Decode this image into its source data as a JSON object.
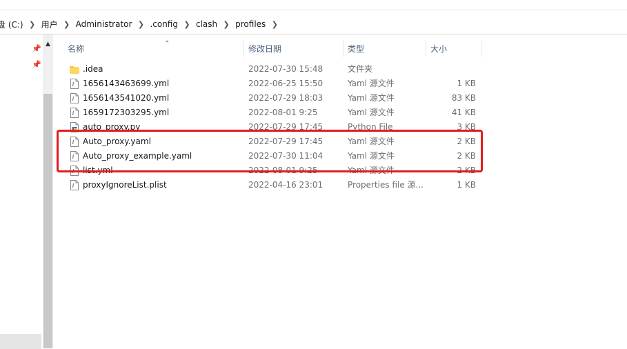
{
  "breadcrumb": {
    "items": [
      "盘 (C:)",
      "用户",
      "Administrator",
      ".config",
      "clash",
      "profiles"
    ]
  },
  "columns": {
    "name": "名称",
    "date": "修改日期",
    "type": "类型",
    "size": "大小"
  },
  "files": [
    {
      "name": ".idea",
      "date": "2022-07-30 15:48",
      "type": "文件夹",
      "size": "",
      "icon": "folder-icon"
    },
    {
      "name": "1656143463699.yml",
      "date": "2022-06-25 15:50",
      "type": "Yaml 源文件",
      "size": "1 KB",
      "icon": "yaml-file-icon"
    },
    {
      "name": "1656143541020.yml",
      "date": "2022-07-29 18:03",
      "type": "Yaml 源文件",
      "size": "83 KB",
      "icon": "yaml-file-icon"
    },
    {
      "name": "1659172303295.yml",
      "date": "2022-08-01 9:25",
      "type": "Yaml 源文件",
      "size": "41 KB",
      "icon": "yaml-file-icon"
    },
    {
      "name": "auto_proxy.py",
      "date": "2022-07-29 17:45",
      "type": "Python File",
      "size": "3 KB",
      "icon": "python-file-icon"
    },
    {
      "name": "Auto_proxy.yaml",
      "date": "2022-07-29 17:45",
      "type": "Yaml 源文件",
      "size": "2 KB",
      "icon": "yaml-file-icon"
    },
    {
      "name": "Auto_proxy_example.yaml",
      "date": "2022-07-30 11:04",
      "type": "Yaml 源文件",
      "size": "2 KB",
      "icon": "yaml-file-icon"
    },
    {
      "name": "list.yml",
      "date": "2022-08-01 9:25",
      "type": "Yaml 源文件",
      "size": "2 KB",
      "icon": "yaml-file-icon"
    },
    {
      "name": "proxyIgnoreList.plist",
      "date": "2022-04-16 23:01",
      "type": "Properties file 源...",
      "size": "1 KB",
      "icon": "plist-file-icon"
    }
  ],
  "colors": {
    "highlight": "#e31b1b",
    "header_text": "#4c607a",
    "folder": "#f5c342"
  }
}
